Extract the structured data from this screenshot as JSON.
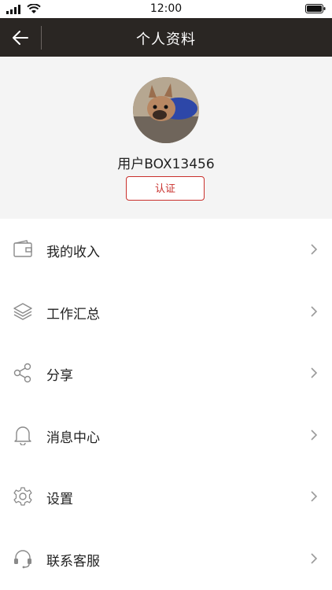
{
  "status": {
    "time": "12:00"
  },
  "nav": {
    "title": "个人资料"
  },
  "profile": {
    "username": "用户BOX13456",
    "auth_label": "认证"
  },
  "colors": {
    "nav_bg": "#2a2623",
    "accent": "#c9302c",
    "profile_bg": "#f4f4f4"
  },
  "menu": [
    {
      "label": "我的收入",
      "icon": "wallet-icon"
    },
    {
      "label": "工作汇总",
      "icon": "layers-icon"
    },
    {
      "label": "分享",
      "icon": "share-icon"
    },
    {
      "label": "消息中心",
      "icon": "bell-icon"
    },
    {
      "label": "设置",
      "icon": "gear-icon"
    },
    {
      "label": "联系客服",
      "icon": "headset-icon"
    }
  ]
}
